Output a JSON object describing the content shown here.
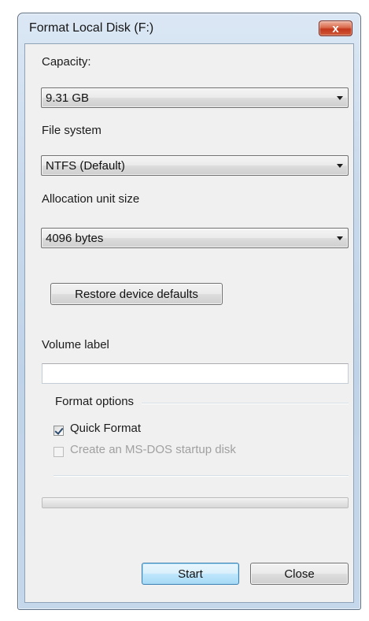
{
  "window": {
    "title": "Format Local Disk (F:)",
    "close_glyph": "x",
    "close_icon": "close-icon"
  },
  "capacity": {
    "label": "Capacity:",
    "value": "9.31 GB"
  },
  "file_system": {
    "label": "File system",
    "value": "NTFS (Default)"
  },
  "allocation": {
    "label": "Allocation unit size",
    "value": "4096 bytes"
  },
  "restore_button": "Restore device defaults",
  "volume": {
    "label": "Volume label",
    "value": ""
  },
  "options": {
    "label": "Format options",
    "quick_format": {
      "label": "Quick Format",
      "checked": true
    },
    "msdos": {
      "label": "Create an MS-DOS startup disk",
      "checked": false,
      "enabled": false
    }
  },
  "progress": {
    "fraction": 0
  },
  "buttons": {
    "start": "Start",
    "close": "Close"
  },
  "colors": {
    "title_bar": "#c9daec",
    "close_button": "#c3371c",
    "default_button_border": "#3c7fb1",
    "client_background": "#f0f0f0"
  }
}
